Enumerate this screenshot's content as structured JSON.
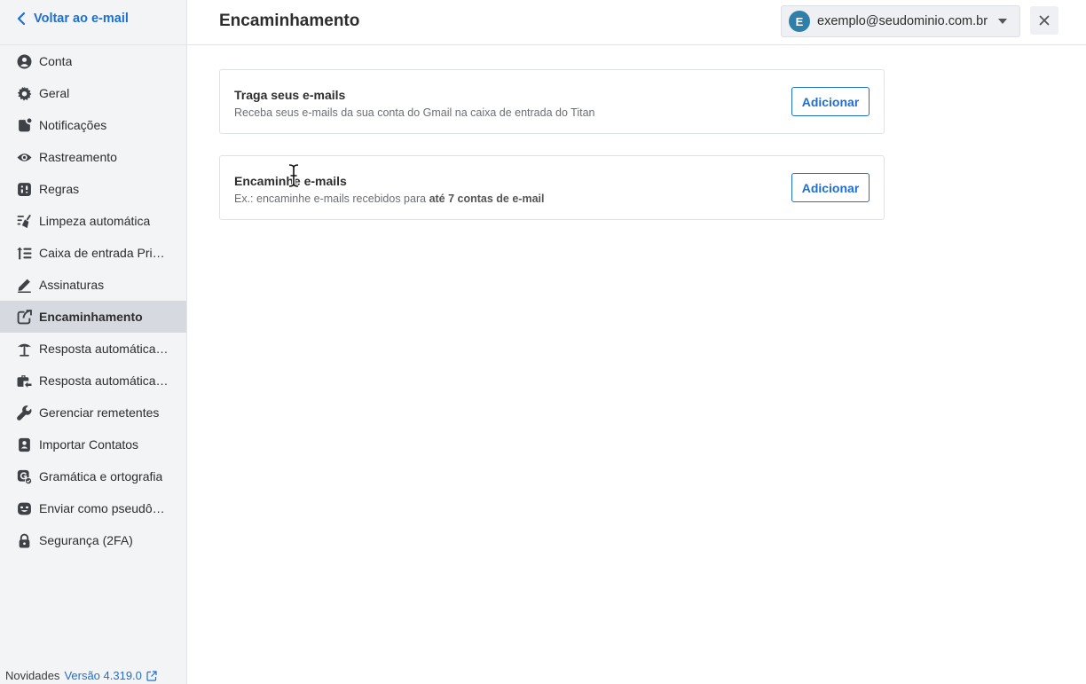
{
  "sidebar": {
    "back_label": "Voltar ao e-mail",
    "items": [
      {
        "label": "Conta",
        "icon": "user-circle-icon"
      },
      {
        "label": "Geral",
        "icon": "gear-icon"
      },
      {
        "label": "Notificações",
        "icon": "notification-icon"
      },
      {
        "label": "Rastreamento",
        "icon": "eye-icon"
      },
      {
        "label": "Regras",
        "icon": "rules-icon"
      },
      {
        "label": "Limpeza automática",
        "icon": "broom-icon"
      },
      {
        "label": "Caixa de entrada Prio...",
        "icon": "priority-list-icon"
      },
      {
        "label": "Assinaturas",
        "icon": "pen-icon"
      },
      {
        "label": "Encaminhamento",
        "icon": "forward-icon",
        "active": true
      },
      {
        "label": "Resposta automática ...",
        "icon": "beach-umbrella-icon"
      },
      {
        "label": "Resposta automática ...",
        "icon": "briefcase-reply-icon"
      },
      {
        "label": "Gerenciar remetentes",
        "icon": "wrench-icon"
      },
      {
        "label": "Importar Contatos",
        "icon": "contact-icon"
      },
      {
        "label": "Gramática e ortografia",
        "icon": "grammar-icon"
      },
      {
        "label": "Enviar como pseudôn...",
        "icon": "mask-icon"
      },
      {
        "label": "Segurança (2FA)",
        "icon": "lock-icon"
      }
    ],
    "footer": {
      "news_label": "Novidades",
      "version_label": "Versão 4.319.0"
    }
  },
  "header": {
    "title": "Encaminhamento",
    "account": {
      "initial": "E",
      "email": "exemplo@seudominio.com.br"
    }
  },
  "cards": [
    {
      "title": "Traga seus e-mails",
      "description": "Receba seus e-mails da sua conta do Gmail na caixa de entrada do Titan",
      "button": "Adicionar"
    },
    {
      "title": "Encaminhe e-mails",
      "description_prefix": "Ex.: encaminhe e-mails recebidos para ",
      "description_bold": "até 7 contas de e-mail",
      "button": "Adicionar"
    }
  ],
  "colors": {
    "accent": "#1f6fd1",
    "sidebar_bg": "#f3f4f6",
    "active_bg": "#d6dae0",
    "avatar": "#2f7fa8"
  }
}
